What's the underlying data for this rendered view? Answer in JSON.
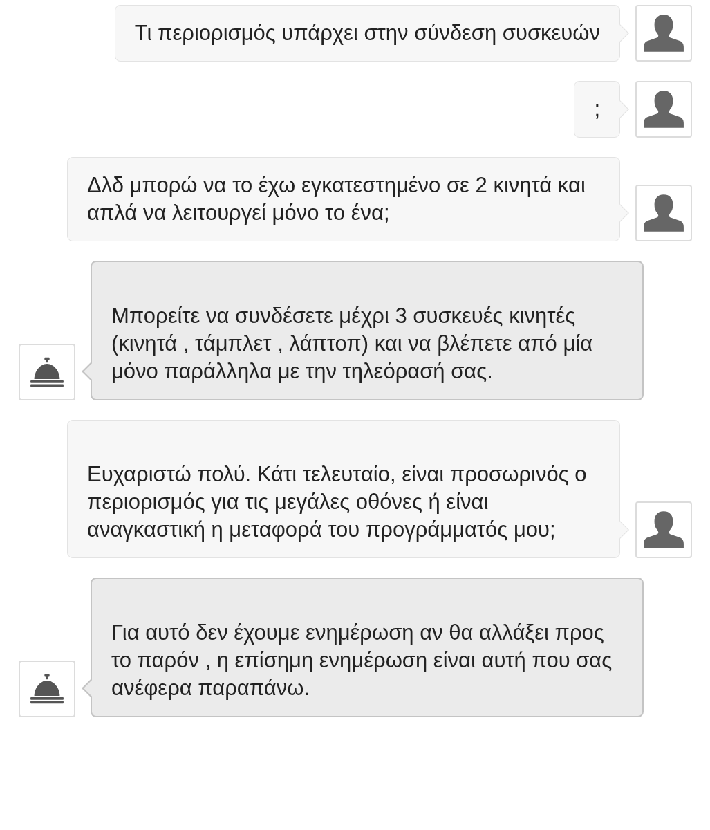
{
  "messages": [
    {
      "kind": "user",
      "text": "Τι περιορισμός υπάρχει στην σύνδεση συσκευών",
      "blank_first_line": false
    },
    {
      "kind": "user",
      "text": ";",
      "blank_first_line": false
    },
    {
      "kind": "user",
      "text": "Δλδ μπορώ να το έχω εγκατεστημένο σε 2 κινητά και απλά να λειτουργεί μόνο το ένα;",
      "blank_first_line": false
    },
    {
      "kind": "agent",
      "text": "Μπορείτε να συνδέσετε μέχρι 3 συσκευές κινητές (κινητά , τάμπλετ , λάπτοπ) και να βλέπετε από μία μόνο παράλληλα με την τηλεόρασή σας.",
      "blank_first_line": true
    },
    {
      "kind": "user",
      "text": "Ευχαριστώ πολύ. Κάτι τελευταίο, είναι προσωρινός ο περιορισμός για τις μεγάλες οθόνες ή είναι αναγκαστική η μεταφορά του προγράμματός μου;",
      "blank_first_line": true
    },
    {
      "kind": "agent",
      "text": "Για αυτό δεν έχουμε ενημέρωση αν θα αλλάξει προς το παρόν , η επίσημη ενημέρωση είναι αυτή που σας ανέφερα παραπάνω.",
      "blank_first_line": true
    }
  ]
}
